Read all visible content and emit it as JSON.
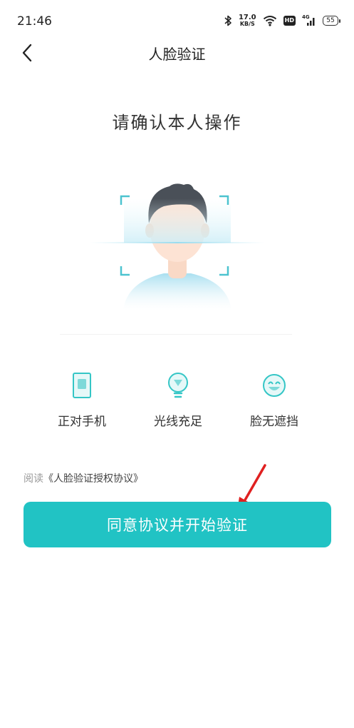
{
  "status_bar": {
    "time": "21:46",
    "net_speed_value": "17.0",
    "net_speed_unit": "KB/S",
    "hd_badge": "HD",
    "network_type": "4G",
    "battery_level": "55",
    "icons": [
      "bluetooth-icon",
      "wifi-icon",
      "hd-icon",
      "signal-icon",
      "battery-icon"
    ]
  },
  "nav": {
    "back_icon": "chevron-left-icon",
    "title": "人脸验证"
  },
  "main": {
    "headline": "请确认本人操作",
    "illustration_icon": "face-scan-icon",
    "tips": [
      {
        "icon": "phone-icon",
        "label": "正对手机"
      },
      {
        "icon": "lightbulb-icon",
        "label": "光线充足"
      },
      {
        "icon": "smile-face-icon",
        "label": "脸无遮挡"
      }
    ]
  },
  "agreement": {
    "prefix": "阅读",
    "link": "《人脸验证授权协议》"
  },
  "start_button": {
    "label": "同意协议并开始验证"
  },
  "colors": {
    "accent": "#21c3c4",
    "arrow": "#e02020",
    "icon_teal": "#35c6c6"
  }
}
